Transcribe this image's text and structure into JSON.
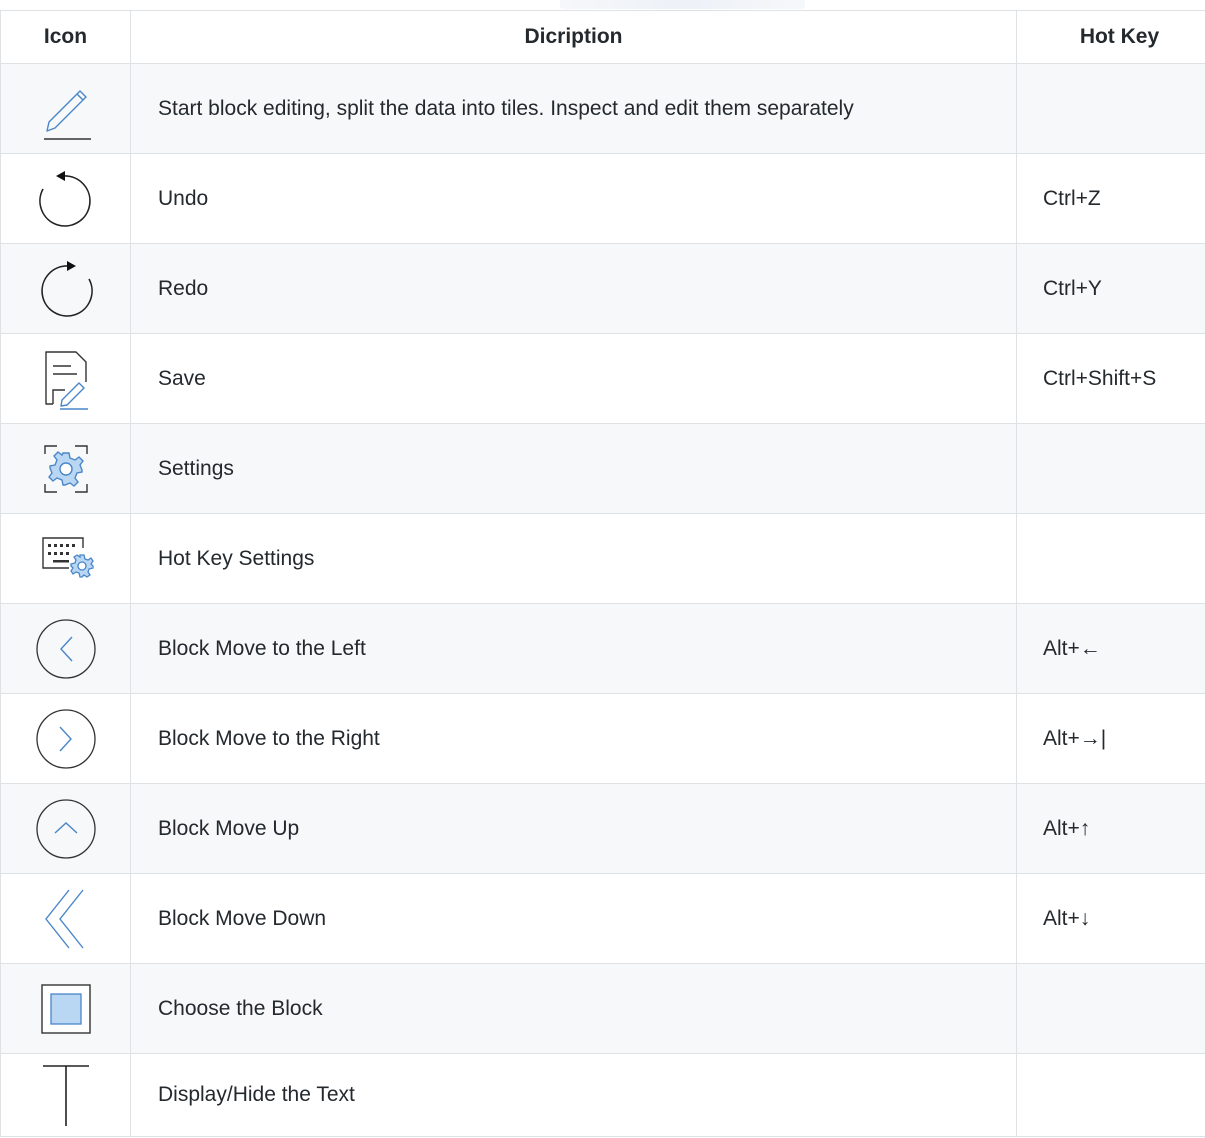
{
  "table": {
    "headers": {
      "icon": "Icon",
      "description": "Dicription",
      "hotkey": "Hot Key"
    },
    "rows": [
      {
        "icon": "pencil-icon",
        "description": "Start block editing, split the data into tiles. Inspect and edit them separately",
        "hotkey": ""
      },
      {
        "icon": "undo-icon",
        "description": "Undo",
        "hotkey": "Ctrl+Z"
      },
      {
        "icon": "redo-icon",
        "description": "Redo",
        "hotkey": "Ctrl+Y"
      },
      {
        "icon": "save-document-icon",
        "description": "Save",
        "hotkey": "Ctrl+Shift+S"
      },
      {
        "icon": "gear-icon",
        "description": "Settings",
        "hotkey": ""
      },
      {
        "icon": "keyboard-gear-icon",
        "description": "Hot Key Settings",
        "hotkey": ""
      },
      {
        "icon": "chevron-left-circle-icon",
        "description": "Block Move to the Left",
        "hotkey": "Alt+←"
      },
      {
        "icon": "chevron-right-circle-icon",
        "description": "Block Move to the Right",
        "hotkey": "Alt+→|"
      },
      {
        "icon": "chevron-up-circle-icon",
        "description": "Block Move Up",
        "hotkey": "Alt+↑"
      },
      {
        "icon": "double-chevron-icon",
        "description": "Block Move Down",
        "hotkey": "Alt+↓"
      },
      {
        "icon": "block-select-icon",
        "description": "Choose the Block",
        "hotkey": ""
      },
      {
        "icon": "text-cursor-icon",
        "description": "Display/Hide the Text",
        "hotkey": ""
      }
    ]
  },
  "colors": {
    "accent": "#4a86c8",
    "border": "#dfe2e5",
    "stripe": "#f6f8fa",
    "text": "#24292e"
  }
}
